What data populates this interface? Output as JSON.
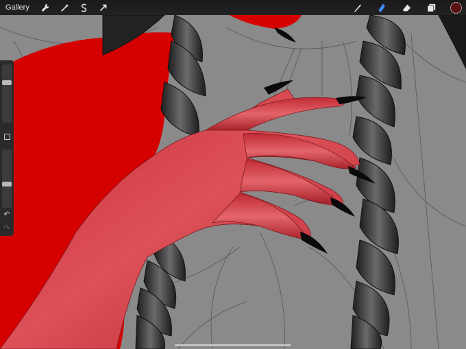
{
  "topbar": {
    "gallery_label": "Gallery",
    "left_icons": [
      "wrench-icon",
      "magic-wand-icon",
      "selection-s-icon",
      "transform-arrow-icon"
    ],
    "right_icons": [
      "brush-icon",
      "smudge-icon",
      "eraser-icon",
      "layers-icon"
    ],
    "active_tool": "smudge",
    "active_color": "#5e0f0f",
    "accent": "#3f8cff"
  },
  "sidebar": {
    "brush_size_level": 0.7,
    "opacity_level": 0.4,
    "modify_icon": "square-modify-icon",
    "undo_icon": "undo-icon",
    "redo_icon": "redo-icon"
  },
  "canvas": {
    "background": "#8a8a8a",
    "fill_color": "#d50000",
    "skin_color": "#d23a42",
    "hair_color": "#333333",
    "line_color": "#5a5a5a",
    "nail_color": "#0a0a0a"
  }
}
